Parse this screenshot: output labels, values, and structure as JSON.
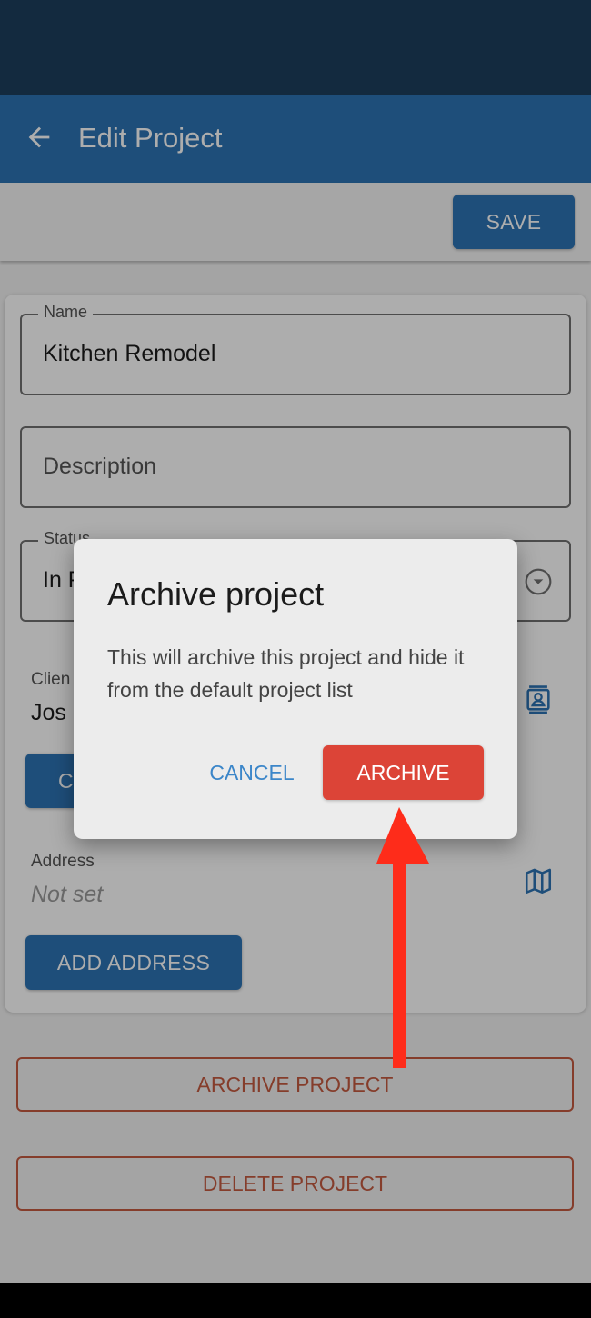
{
  "app_bar": {
    "title": "Edit Project",
    "back_icon": "arrow-left-icon"
  },
  "toolbar": {
    "save_label": "SAVE"
  },
  "form": {
    "name": {
      "label": "Name",
      "value": "Kitchen Remodel"
    },
    "description": {
      "placeholder": "Description"
    },
    "status": {
      "label": "Status",
      "value": "In P",
      "icon": "chevron-down-icon"
    },
    "client": {
      "label": "Clien",
      "name": "Jos",
      "icon": "contact-card-icon",
      "button_label": "C"
    },
    "address": {
      "label": "Address",
      "value": "Not set",
      "icon": "map-icon",
      "add_label": "ADD ADDRESS"
    }
  },
  "actions": {
    "archive_label": "ARCHIVE PROJECT",
    "delete_label": "DELETE PROJECT"
  },
  "dialog": {
    "title": "Archive project",
    "body": "This will archive this project and hide it from the default project list",
    "cancel_label": "CANCEL",
    "confirm_label": "ARCHIVE"
  },
  "colors": {
    "primary": "#2d74b4",
    "status_bar": "#1d3f5e",
    "danger": "#dc4437",
    "outline_danger": "#c45a40",
    "annotation": "#fe2c1a"
  }
}
